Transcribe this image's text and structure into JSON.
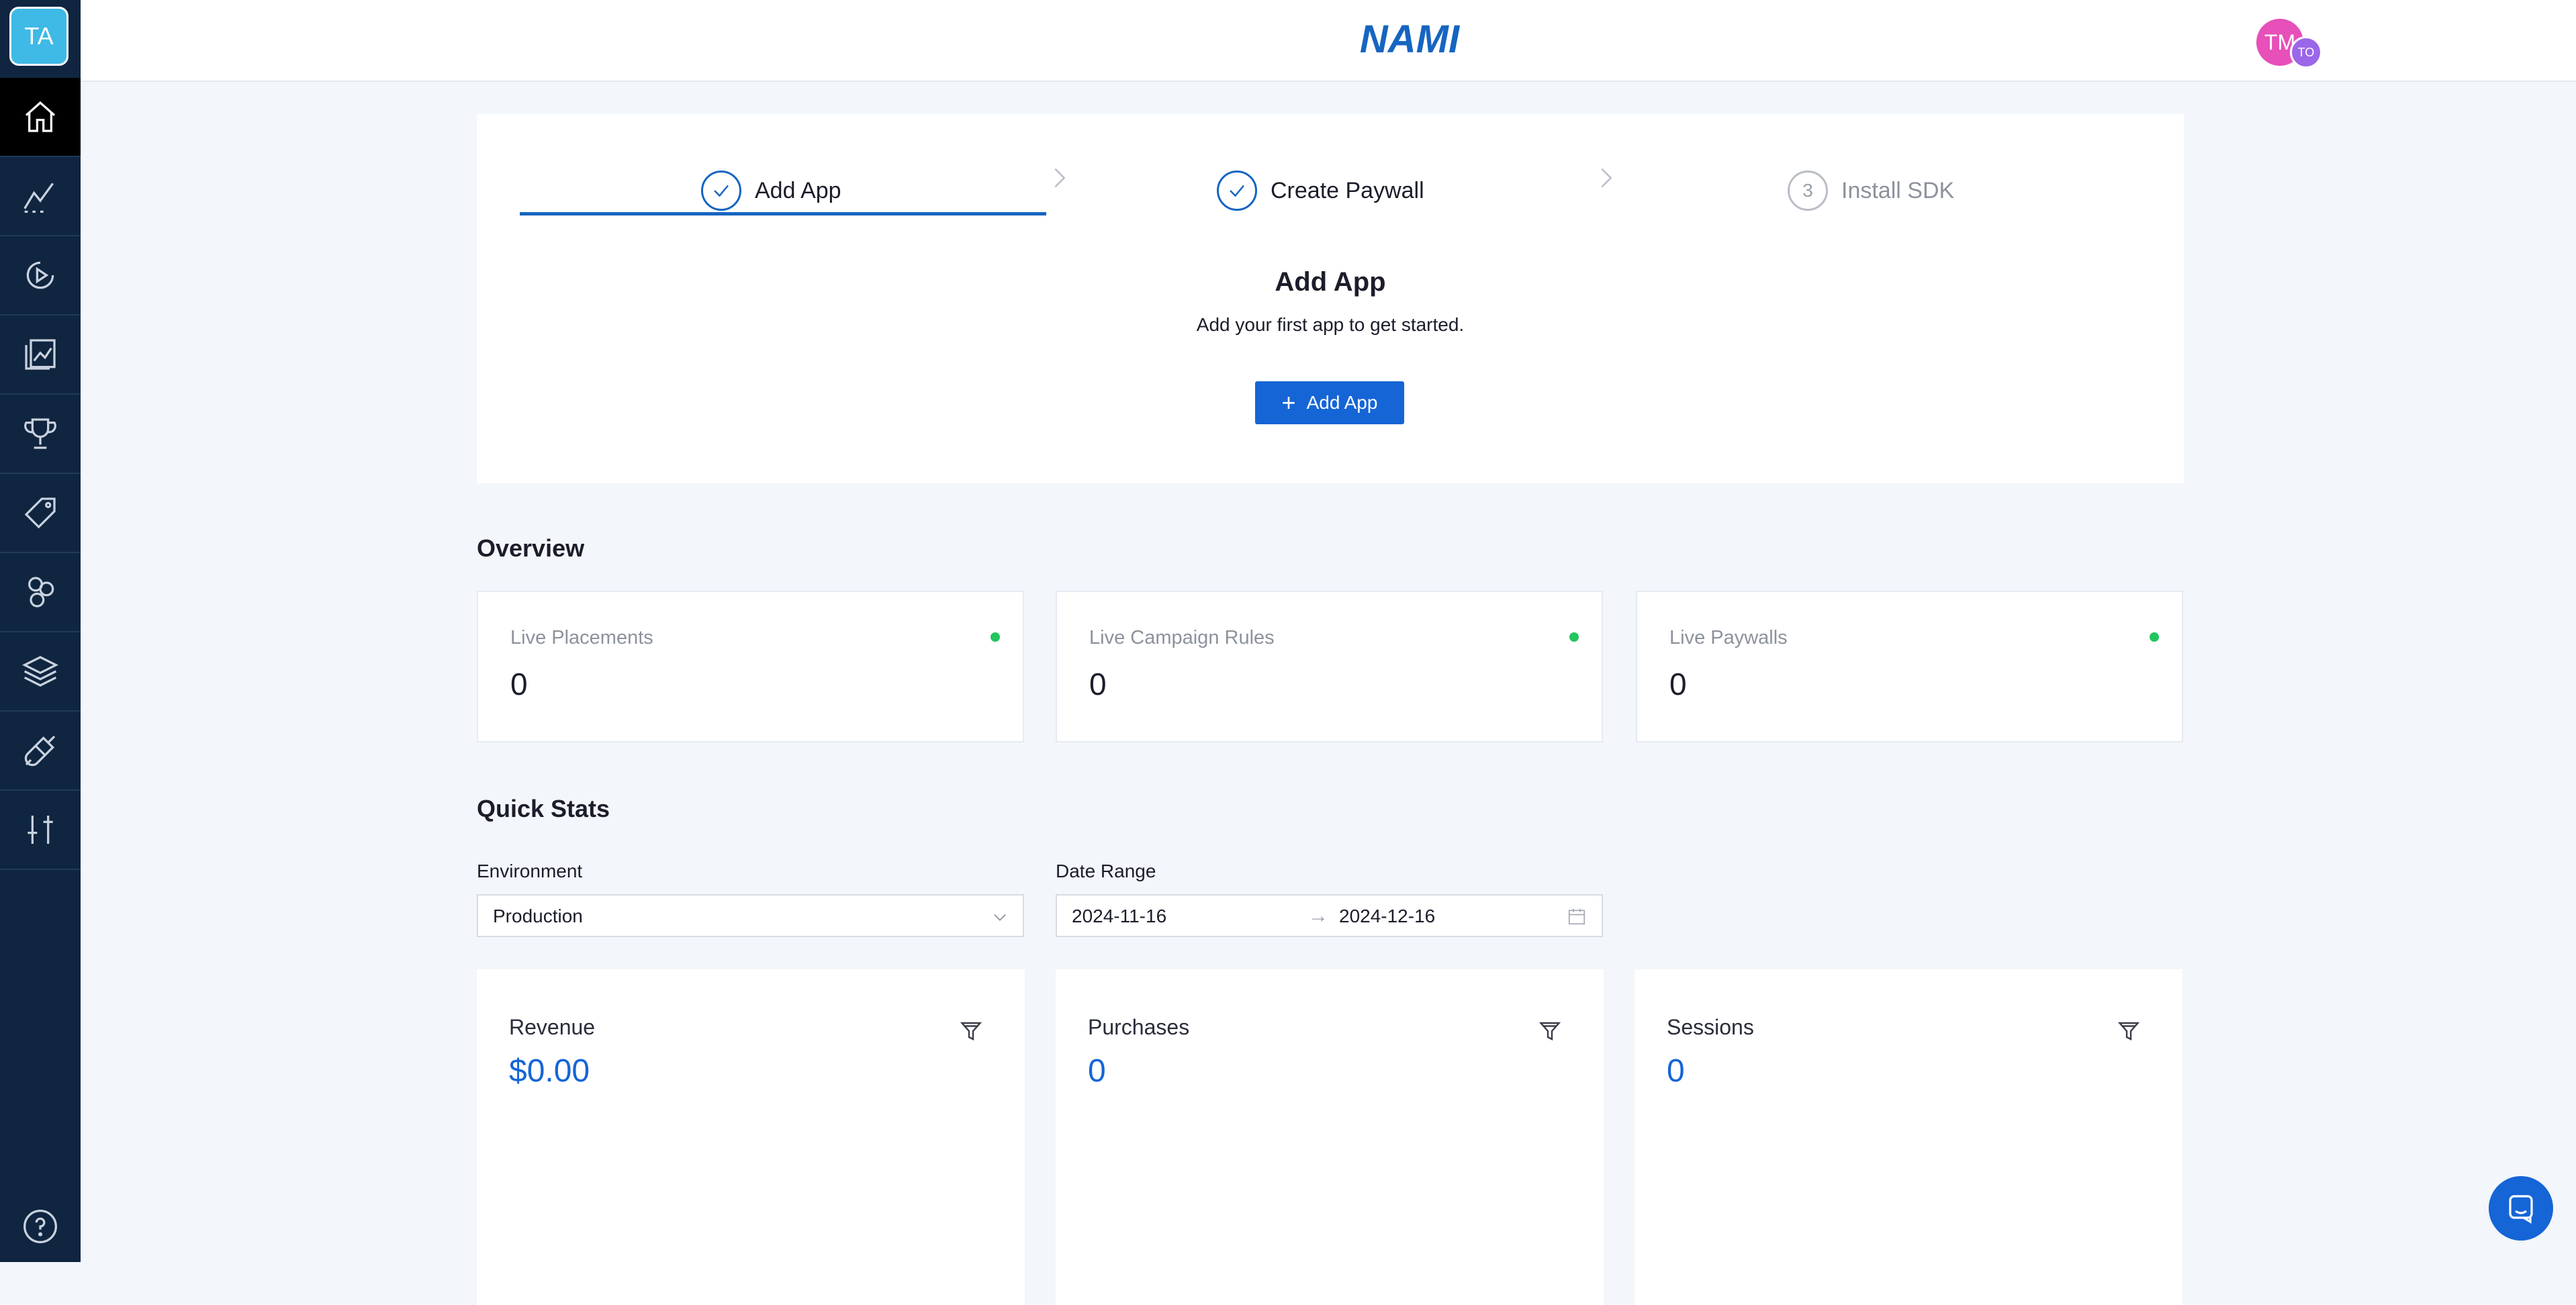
{
  "sidebar": {
    "team_initials": "TA",
    "items": [
      {
        "icon": "home-icon",
        "active": true
      },
      {
        "icon": "analytics-icon"
      },
      {
        "icon": "campaigns-icon"
      },
      {
        "icon": "paywalls-icon"
      },
      {
        "icon": "trophy-icon"
      },
      {
        "icon": "tag-icon"
      },
      {
        "icon": "customers-icon"
      },
      {
        "icon": "layers-icon"
      },
      {
        "icon": "integrations-icon"
      },
      {
        "icon": "settings-sliders-icon"
      }
    ],
    "help_icon": "help-icon"
  },
  "header": {
    "logo_text": "NAMI",
    "user_initials": "TM",
    "org_initials": "TO"
  },
  "steps": {
    "items": [
      {
        "label": "Add App",
        "status": "complete"
      },
      {
        "label": "Create Paywall",
        "status": "complete"
      },
      {
        "label": "Install SDK",
        "status": "pending",
        "number": "3"
      }
    ],
    "title": "Add App",
    "subtitle": "Add your first app to get started.",
    "button_label": "Add App"
  },
  "overview": {
    "title": "Overview",
    "cards": [
      {
        "label": "Live Placements",
        "value": "0",
        "status_color": "#22c55e"
      },
      {
        "label": "Live Campaign Rules",
        "value": "0",
        "status_color": "#22c55e"
      },
      {
        "label": "Live Paywalls",
        "value": "0",
        "status_color": "#22c55e"
      }
    ]
  },
  "quick_stats": {
    "title": "Quick Stats",
    "environment_label": "Environment",
    "environment_value": "Production",
    "date_range_label": "Date Range",
    "date_start": "2024-11-16",
    "date_arrow": "→",
    "date_end": "2024-12-16",
    "cards": [
      {
        "label": "Revenue",
        "value": "$0.00"
      },
      {
        "label": "Purchases",
        "value": "0"
      },
      {
        "label": "Sessions",
        "value": "0"
      }
    ]
  },
  "colors": {
    "sidebar_bg": "#0f2540",
    "accent": "#1565d6",
    "live_dot": "#22c55e"
  }
}
